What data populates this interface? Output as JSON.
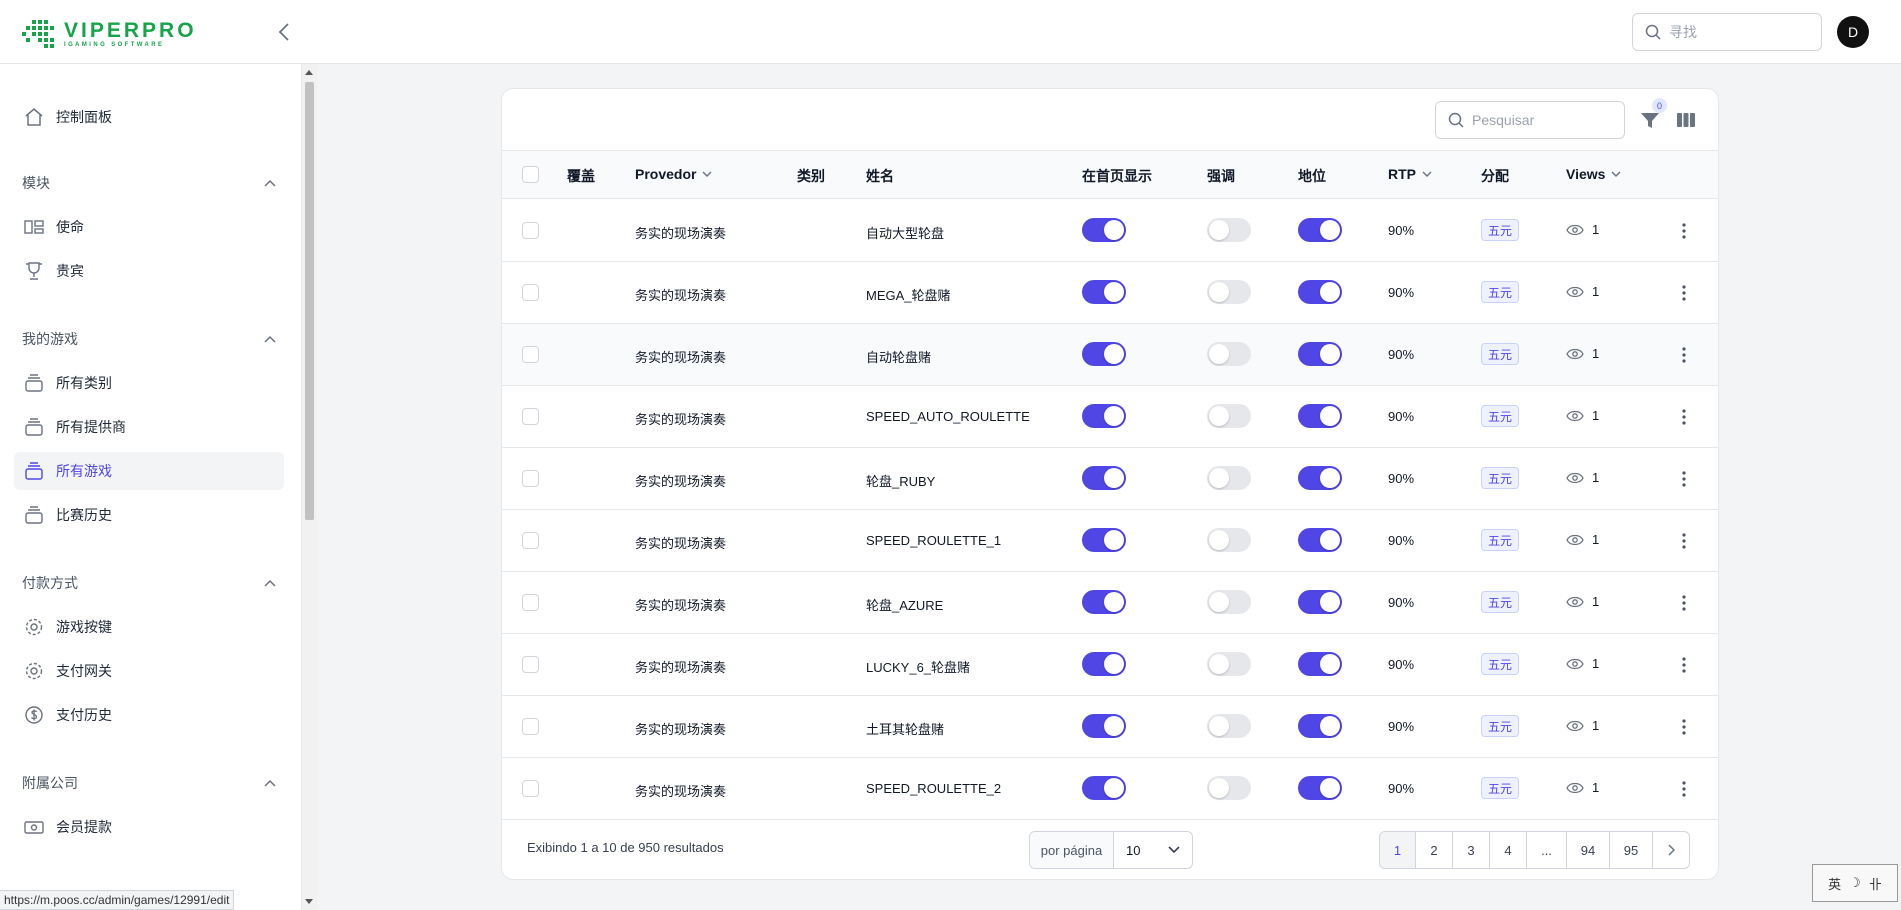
{
  "header": {
    "logo_name": "VIPERPRO",
    "logo_sub": "IGAMING SOFTWARE",
    "search_placeholder": "寻找",
    "avatar_letter": "D"
  },
  "sidebar": {
    "dashboard": "控制面板",
    "groups": {
      "modules": "模块",
      "my_games": "我的游戏",
      "payments": "付款方式",
      "affiliates": "附属公司"
    },
    "items": {
      "missions": "使命",
      "vip": "贵宾",
      "all_categories": "所有类别",
      "all_providers": "所有提供商",
      "all_games": "所有游戏",
      "match_history": "比赛历史",
      "game_keys": "游戏按键",
      "payment_gateway": "支付网关",
      "payment_history": "支付历史",
      "member_withdraw": "会员提款"
    }
  },
  "table": {
    "search_placeholder": "Pesquisar",
    "filter_count": "0",
    "columns": {
      "cover": "覆盖",
      "provider": "Provedor",
      "category": "类别",
      "name": "姓名",
      "home": "在首页显示",
      "highlight": "强调",
      "status": "地位",
      "rtp": "RTP",
      "distribution": "分配",
      "views": "Views"
    },
    "rows": [
      {
        "provider": "务实的现场演奏",
        "name": "自动大型轮盘",
        "rtp": "90%",
        "dist": "五元",
        "views": "1"
      },
      {
        "provider": "务实的现场演奏",
        "name": "MEGA_轮盘赌",
        "rtp": "90%",
        "dist": "五元",
        "views": "1"
      },
      {
        "provider": "务实的现场演奏",
        "name": "自动轮盘赌",
        "rtp": "90%",
        "dist": "五元",
        "views": "1"
      },
      {
        "provider": "务实的现场演奏",
        "name": "SPEED_AUTO_ROULETTE",
        "rtp": "90%",
        "dist": "五元",
        "views": "1"
      },
      {
        "provider": "务实的现场演奏",
        "name": "轮盘_RUBY",
        "rtp": "90%",
        "dist": "五元",
        "views": "1"
      },
      {
        "provider": "务实的现场演奏",
        "name": "SPEED_ROULETTE_1",
        "rtp": "90%",
        "dist": "五元",
        "views": "1"
      },
      {
        "provider": "务实的现场演奏",
        "name": "轮盘_AZURE",
        "rtp": "90%",
        "dist": "五元",
        "views": "1"
      },
      {
        "provider": "务实的现场演奏",
        "name": "LUCKY_6_轮盘赌",
        "rtp": "90%",
        "dist": "五元",
        "views": "1"
      },
      {
        "provider": "务实的现场演奏",
        "name": "土耳其轮盘赌",
        "rtp": "90%",
        "dist": "五元",
        "views": "1"
      },
      {
        "provider": "务实的现场演奏",
        "name": "SPEED_ROULETTE_2",
        "rtp": "90%",
        "dist": "五元",
        "views": "1"
      }
    ],
    "footer": {
      "results": "Exibindo 1 a 10 de 950 resultados",
      "per_page_label": "por página",
      "per_page_value": "10",
      "pages": [
        "1",
        "2",
        "3",
        "4",
        "...",
        "94",
        "95"
      ]
    }
  },
  "statusbar": {
    "url": "https://m.poos.cc/admin/games/12991/edit"
  },
  "ime": {
    "lang": "英",
    "moon": "☽",
    "mode": "卝"
  },
  "colors": {
    "accent": "#4f46e5",
    "brand": "#16a34a"
  }
}
